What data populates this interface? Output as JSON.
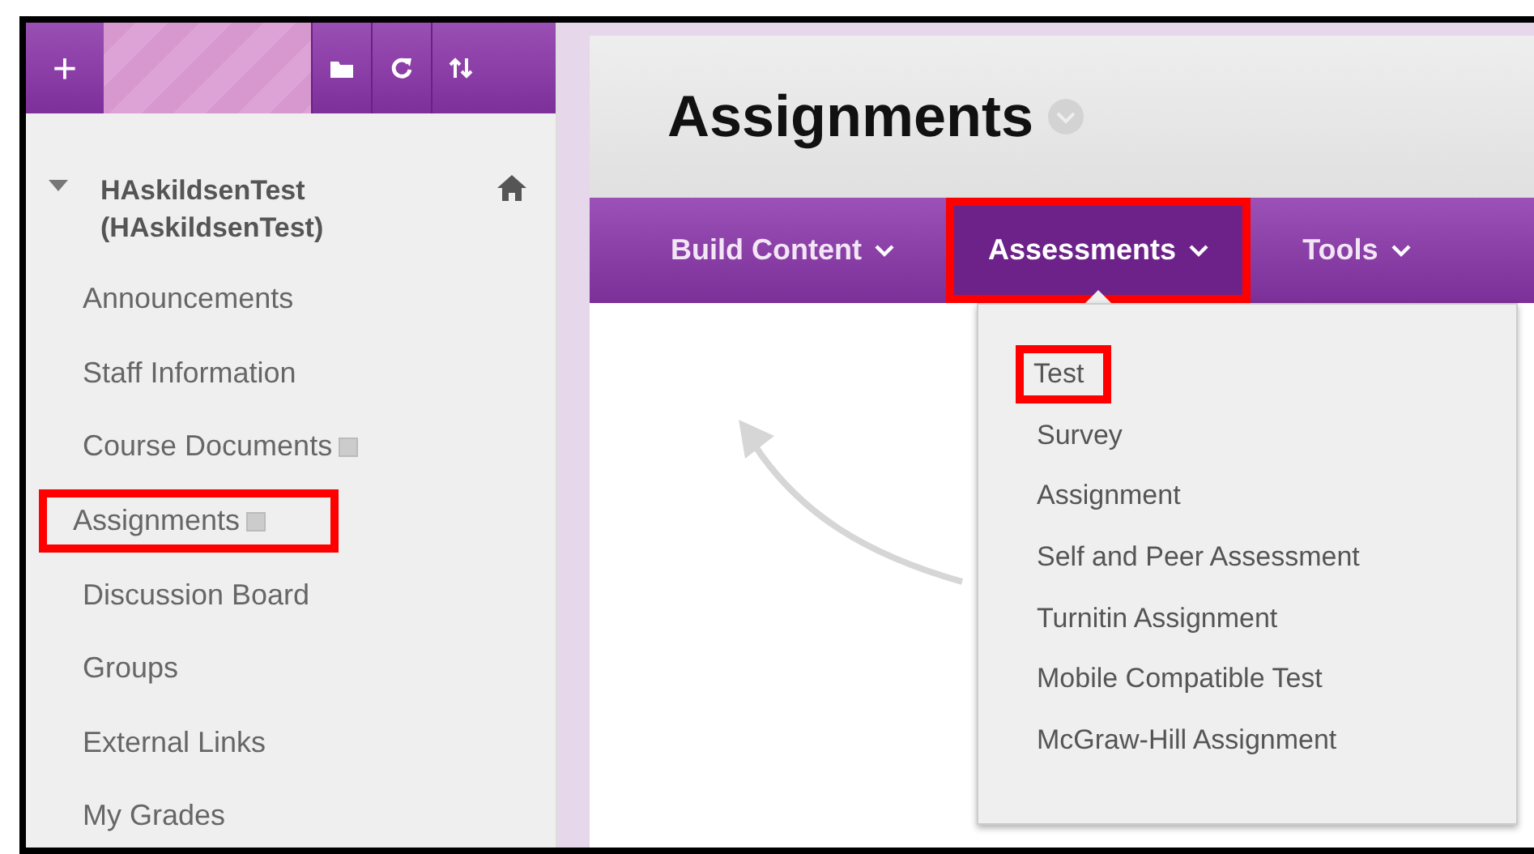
{
  "sidebar": {
    "toolbar": {
      "buttons": [
        {
          "kind": "add",
          "label": "+"
        },
        {
          "kind": "folder"
        },
        {
          "kind": "refresh"
        },
        {
          "kind": "sort"
        }
      ]
    },
    "course": {
      "title": "HAskildsenTest (HAskildsenTest)",
      "expanded": true
    },
    "items": [
      {
        "label": "Announcements",
        "has_icon": false,
        "highlighted": false
      },
      {
        "label": "Staff Information",
        "has_icon": false,
        "highlighted": false
      },
      {
        "label": "Course Documents",
        "has_icon": true,
        "highlighted": false
      },
      {
        "label": "Assignments",
        "has_icon": true,
        "highlighted": true
      },
      {
        "label": "Discussion Board",
        "has_icon": false,
        "highlighted": false
      },
      {
        "label": "Groups",
        "has_icon": false,
        "highlighted": false
      },
      {
        "label": "External Links",
        "has_icon": false,
        "highlighted": false
      },
      {
        "label": "My Grades",
        "has_icon": false,
        "highlighted": false
      }
    ]
  },
  "page": {
    "title": "Assignments"
  },
  "tabs": [
    {
      "label": "Build Content",
      "selected": false,
      "highlighted": false
    },
    {
      "label": "Assessments",
      "selected": true,
      "highlighted": true
    },
    {
      "label": "Tools",
      "selected": false,
      "highlighted": false
    }
  ],
  "menu": {
    "items": [
      {
        "label": "Test",
        "highlighted": true
      },
      {
        "label": "Survey",
        "highlighted": false
      },
      {
        "label": "Assignment",
        "highlighted": false
      },
      {
        "label": "Self and Peer Assessment",
        "highlighted": false
      },
      {
        "label": "Turnitin Assignment",
        "highlighted": false
      },
      {
        "label": "Mobile Compatible Test",
        "highlighted": false
      },
      {
        "label": "McGraw-Hill Assignment",
        "highlighted": false
      }
    ]
  }
}
